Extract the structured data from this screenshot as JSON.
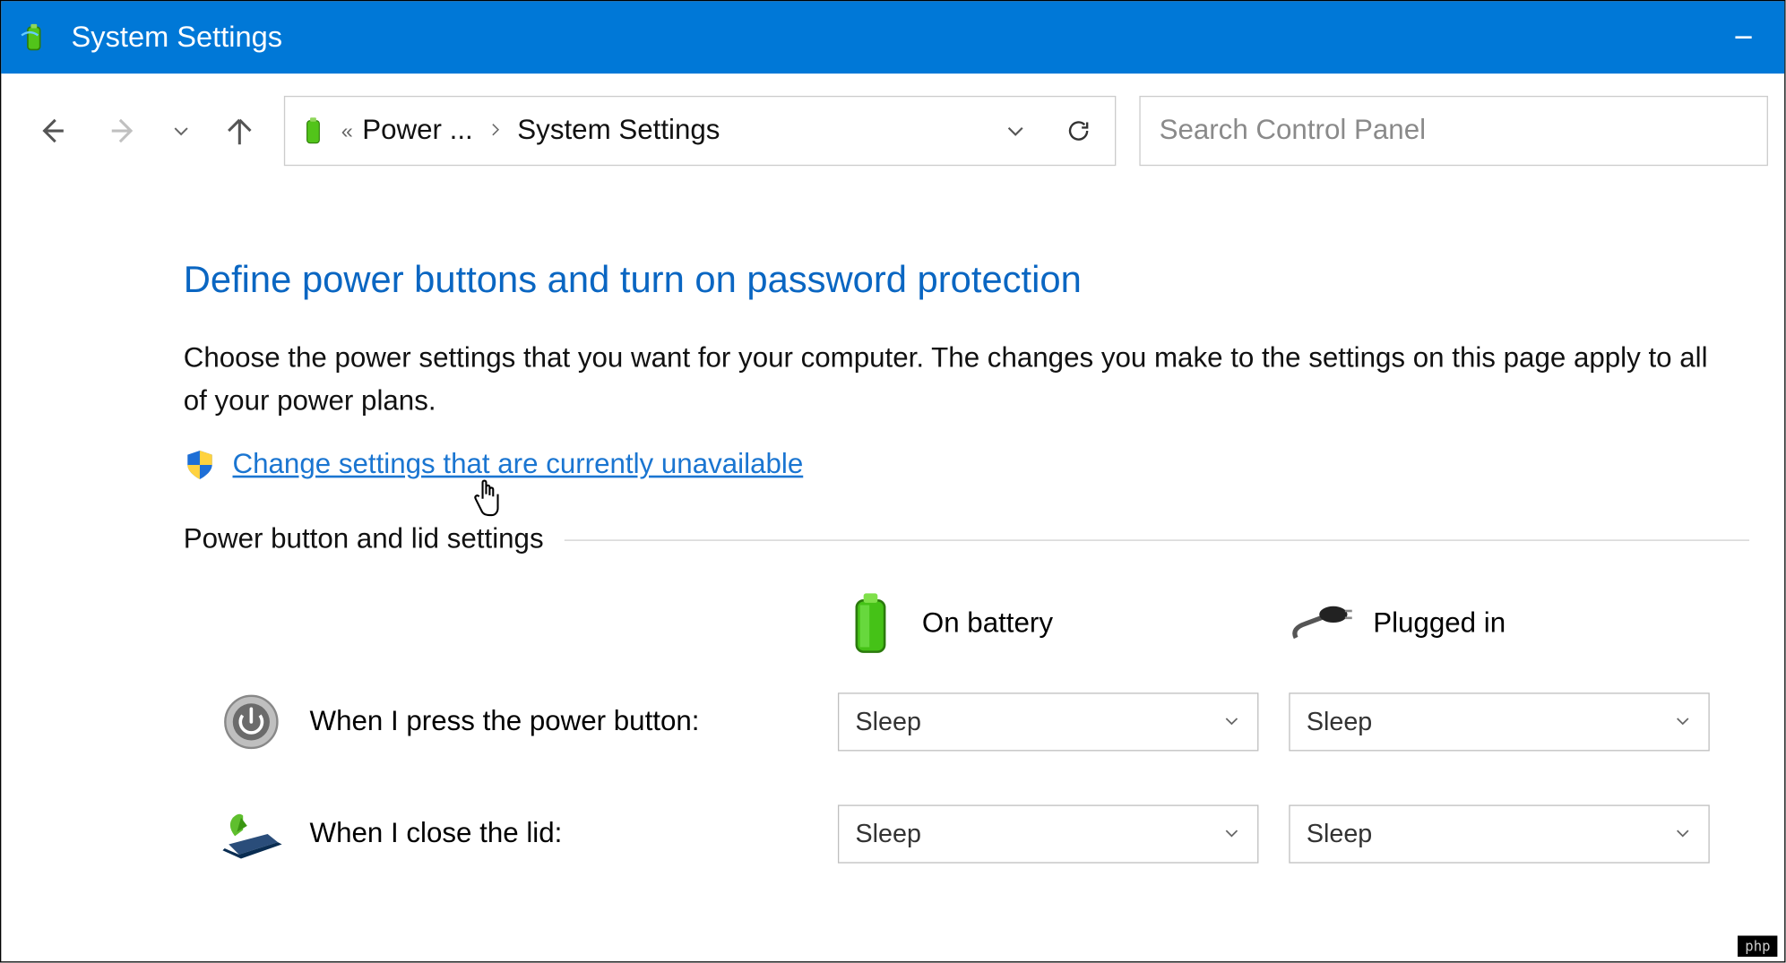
{
  "window": {
    "title": "System Settings"
  },
  "breadcrumb": {
    "parent_truncated": "Power ...",
    "current": "System Settings"
  },
  "search": {
    "placeholder": "Search Control Panel"
  },
  "page": {
    "heading": "Define power buttons and turn on password protection",
    "description": "Choose the power settings that you want for your computer. The changes you make to the settings on this page apply to all of your power plans.",
    "uac_link": "Change settings that are currently unavailable",
    "section_label": "Power button and lid settings",
    "columns": {
      "battery": "On battery",
      "plugged": "Plugged in"
    },
    "rows": [
      {
        "label": "When I press the power button:",
        "battery_value": "Sleep",
        "plugged_value": "Sleep"
      },
      {
        "label": "When I close the lid:",
        "battery_value": "Sleep",
        "plugged_value": "Sleep"
      }
    ]
  },
  "watermark": "php"
}
